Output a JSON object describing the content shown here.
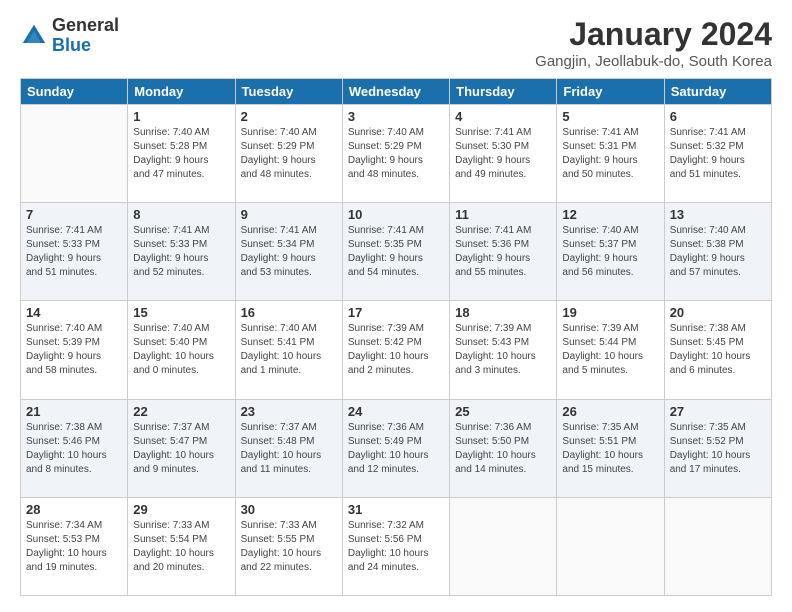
{
  "logo": {
    "general": "General",
    "blue": "Blue"
  },
  "title": "January 2024",
  "location": "Gangjin, Jeollabuk-do, South Korea",
  "days_header": [
    "Sunday",
    "Monday",
    "Tuesday",
    "Wednesday",
    "Thursday",
    "Friday",
    "Saturday"
  ],
  "weeks": [
    [
      {
        "day": "",
        "info": ""
      },
      {
        "day": "1",
        "info": "Sunrise: 7:40 AM\nSunset: 5:28 PM\nDaylight: 9 hours\nand 47 minutes."
      },
      {
        "day": "2",
        "info": "Sunrise: 7:40 AM\nSunset: 5:29 PM\nDaylight: 9 hours\nand 48 minutes."
      },
      {
        "day": "3",
        "info": "Sunrise: 7:40 AM\nSunset: 5:29 PM\nDaylight: 9 hours\nand 48 minutes."
      },
      {
        "day": "4",
        "info": "Sunrise: 7:41 AM\nSunset: 5:30 PM\nDaylight: 9 hours\nand 49 minutes."
      },
      {
        "day": "5",
        "info": "Sunrise: 7:41 AM\nSunset: 5:31 PM\nDaylight: 9 hours\nand 50 minutes."
      },
      {
        "day": "6",
        "info": "Sunrise: 7:41 AM\nSunset: 5:32 PM\nDaylight: 9 hours\nand 51 minutes."
      }
    ],
    [
      {
        "day": "7",
        "info": "Sunrise: 7:41 AM\nSunset: 5:33 PM\nDaylight: 9 hours\nand 51 minutes."
      },
      {
        "day": "8",
        "info": "Sunrise: 7:41 AM\nSunset: 5:33 PM\nDaylight: 9 hours\nand 52 minutes."
      },
      {
        "day": "9",
        "info": "Sunrise: 7:41 AM\nSunset: 5:34 PM\nDaylight: 9 hours\nand 53 minutes."
      },
      {
        "day": "10",
        "info": "Sunrise: 7:41 AM\nSunset: 5:35 PM\nDaylight: 9 hours\nand 54 minutes."
      },
      {
        "day": "11",
        "info": "Sunrise: 7:41 AM\nSunset: 5:36 PM\nDaylight: 9 hours\nand 55 minutes."
      },
      {
        "day": "12",
        "info": "Sunrise: 7:40 AM\nSunset: 5:37 PM\nDaylight: 9 hours\nand 56 minutes."
      },
      {
        "day": "13",
        "info": "Sunrise: 7:40 AM\nSunset: 5:38 PM\nDaylight: 9 hours\nand 57 minutes."
      }
    ],
    [
      {
        "day": "14",
        "info": "Sunrise: 7:40 AM\nSunset: 5:39 PM\nDaylight: 9 hours\nand 58 minutes."
      },
      {
        "day": "15",
        "info": "Sunrise: 7:40 AM\nSunset: 5:40 PM\nDaylight: 10 hours\nand 0 minutes."
      },
      {
        "day": "16",
        "info": "Sunrise: 7:40 AM\nSunset: 5:41 PM\nDaylight: 10 hours\nand 1 minute."
      },
      {
        "day": "17",
        "info": "Sunrise: 7:39 AM\nSunset: 5:42 PM\nDaylight: 10 hours\nand 2 minutes."
      },
      {
        "day": "18",
        "info": "Sunrise: 7:39 AM\nSunset: 5:43 PM\nDaylight: 10 hours\nand 3 minutes."
      },
      {
        "day": "19",
        "info": "Sunrise: 7:39 AM\nSunset: 5:44 PM\nDaylight: 10 hours\nand 5 minutes."
      },
      {
        "day": "20",
        "info": "Sunrise: 7:38 AM\nSunset: 5:45 PM\nDaylight: 10 hours\nand 6 minutes."
      }
    ],
    [
      {
        "day": "21",
        "info": "Sunrise: 7:38 AM\nSunset: 5:46 PM\nDaylight: 10 hours\nand 8 minutes."
      },
      {
        "day": "22",
        "info": "Sunrise: 7:37 AM\nSunset: 5:47 PM\nDaylight: 10 hours\nand 9 minutes."
      },
      {
        "day": "23",
        "info": "Sunrise: 7:37 AM\nSunset: 5:48 PM\nDaylight: 10 hours\nand 11 minutes."
      },
      {
        "day": "24",
        "info": "Sunrise: 7:36 AM\nSunset: 5:49 PM\nDaylight: 10 hours\nand 12 minutes."
      },
      {
        "day": "25",
        "info": "Sunrise: 7:36 AM\nSunset: 5:50 PM\nDaylight: 10 hours\nand 14 minutes."
      },
      {
        "day": "26",
        "info": "Sunrise: 7:35 AM\nSunset: 5:51 PM\nDaylight: 10 hours\nand 15 minutes."
      },
      {
        "day": "27",
        "info": "Sunrise: 7:35 AM\nSunset: 5:52 PM\nDaylight: 10 hours\nand 17 minutes."
      }
    ],
    [
      {
        "day": "28",
        "info": "Sunrise: 7:34 AM\nSunset: 5:53 PM\nDaylight: 10 hours\nand 19 minutes."
      },
      {
        "day": "29",
        "info": "Sunrise: 7:33 AM\nSunset: 5:54 PM\nDaylight: 10 hours\nand 20 minutes."
      },
      {
        "day": "30",
        "info": "Sunrise: 7:33 AM\nSunset: 5:55 PM\nDaylight: 10 hours\nand 22 minutes."
      },
      {
        "day": "31",
        "info": "Sunrise: 7:32 AM\nSunset: 5:56 PM\nDaylight: 10 hours\nand 24 minutes."
      },
      {
        "day": "",
        "info": ""
      },
      {
        "day": "",
        "info": ""
      },
      {
        "day": "",
        "info": ""
      }
    ]
  ]
}
